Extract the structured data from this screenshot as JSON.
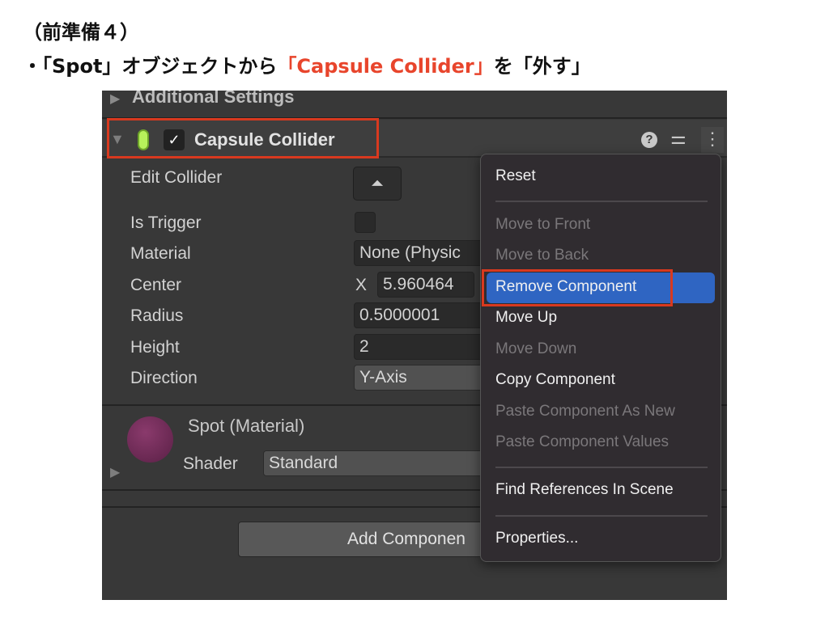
{
  "slide": {
    "title": "（前準備４）",
    "bullet_prefix": "・「Spot」オブジェクトから",
    "bullet_highlight": "「Capsule Collider」",
    "bullet_suffix": "を「外す」",
    "highlight_color": "#e8452c"
  },
  "inspector": {
    "additional_settings": "Additional Settings",
    "component": {
      "title": "Capsule Collider",
      "enabled": true,
      "icon": "capsule-collider-icon",
      "header_icons": [
        "help-icon",
        "presets-icon",
        "more-vertical-icon"
      ]
    },
    "fields": {
      "edit_collider": "Edit Collider",
      "is_trigger": "Is Trigger",
      "is_trigger_value": false,
      "material": "Material",
      "material_value": "None (Physic",
      "center": "Center",
      "center_axis": "X",
      "center_x": "5.960464",
      "radius": "Radius",
      "radius_value": "0.5000001",
      "height": "Height",
      "height_value": "2",
      "direction": "Direction",
      "direction_value": "Y-Axis"
    },
    "material_section": {
      "name": "Spot (Material)",
      "shader_label": "Shader",
      "shader_value": "Standard",
      "preview_color": "#6e2a55"
    },
    "add_component": "Add Componen"
  },
  "context_menu": {
    "items": [
      {
        "label": "Reset",
        "enabled": true
      },
      {
        "label": "Move to Front",
        "enabled": false
      },
      {
        "label": "Move to Back",
        "enabled": false
      },
      {
        "label": "Remove Component",
        "enabled": true,
        "highlighted": true
      },
      {
        "label": "Move Up",
        "enabled": true
      },
      {
        "label": "Move Down",
        "enabled": false
      },
      {
        "label": "Copy Component",
        "enabled": true
      },
      {
        "label": "Paste Component As New",
        "enabled": false
      },
      {
        "label": "Paste Component Values",
        "enabled": false
      },
      {
        "label": "Find References In Scene",
        "enabled": true
      },
      {
        "label": "Properties...",
        "enabled": true
      }
    ],
    "highlight_color": "#2f65c2"
  }
}
